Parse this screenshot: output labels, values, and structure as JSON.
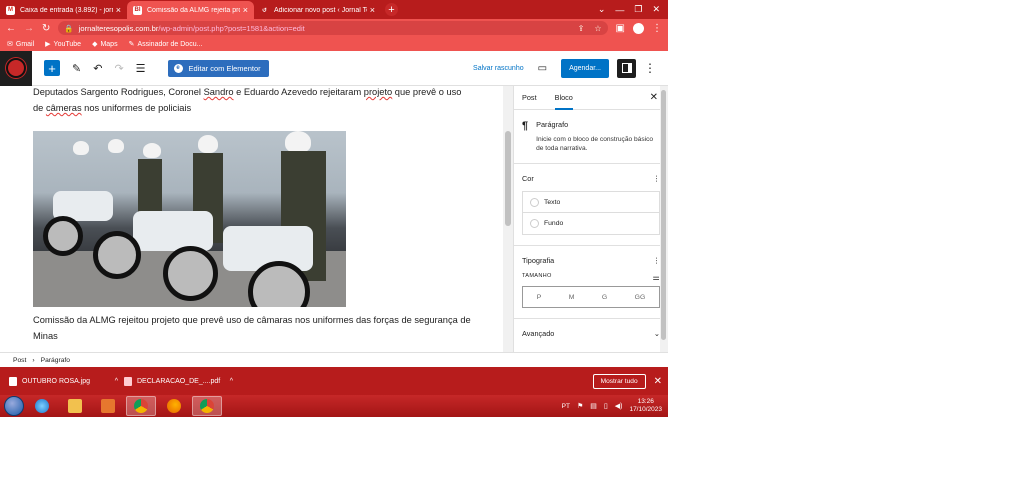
{
  "browser": {
    "tabs": [
      {
        "favicon": "gmail-icon",
        "title": "Caixa de entrada (3.892) - jornalt",
        "active": false
      },
      {
        "favicon": "site-icon",
        "title": "Comissão da ALMG rejeita projet",
        "active": true
      },
      {
        "favicon": "wordpress-icon",
        "title": "Adicionar novo post ‹ Jornal Tere",
        "active": false
      }
    ],
    "url_host": "jornalteresopolis.com.br",
    "url_path": "/wp-admin/post.php?post=1581&action=edit",
    "bookmarks": [
      "Gmail",
      "YouTube",
      "Maps",
      "Assinador de Docu..."
    ]
  },
  "editor": {
    "elementor_label": "Editar com Elementor",
    "save_draft_label": "Salvar rascunho",
    "schedule_label": "Agendar...",
    "caption_top_pre": "Deputados Sargento Rodrigues, Coronel ",
    "caption_top_sandro": "Sandro",
    "caption_top_mid": " e Eduardo Azevedo rejeitaram ",
    "caption_top_projeto": "projeto",
    "caption_top_post": " que prevê o uso",
    "caption_top_line2_pre": "de ",
    "caption_top_cameras": "câmeras",
    "caption_top_line2_post": " nos uniformes de policiais",
    "caption_bottom": "Comissão da ALMG rejeitou projeto que prevê uso de câmaras nos uniformes das forças de segurança de Minas"
  },
  "panel": {
    "tab_post": "Post",
    "tab_block": "Bloco",
    "block_name": "Parágrafo",
    "block_desc": "Inicie com o bloco de construção básico de toda narrativa.",
    "color_title": "Cor",
    "color_text": "Texto",
    "color_bg": "Fundo",
    "typo_title": "Tipografia",
    "size_label": "TAMANHO",
    "sizes": [
      "P",
      "M",
      "G",
      "GG"
    ],
    "advanced": "Avançado"
  },
  "breadcrumb": [
    "Post",
    "Parágrafo"
  ],
  "downloads": [
    {
      "name": "OUTUBRO ROSA.jpg",
      "type": "jpg"
    },
    {
      "name": "DECLARACAO_DE_....pdf",
      "type": "pdf"
    }
  ],
  "downloads_show_all": "Mostrar tudo",
  "taskbar": {
    "lang": "PT",
    "time": "13:26",
    "date": "17/10/2023"
  }
}
